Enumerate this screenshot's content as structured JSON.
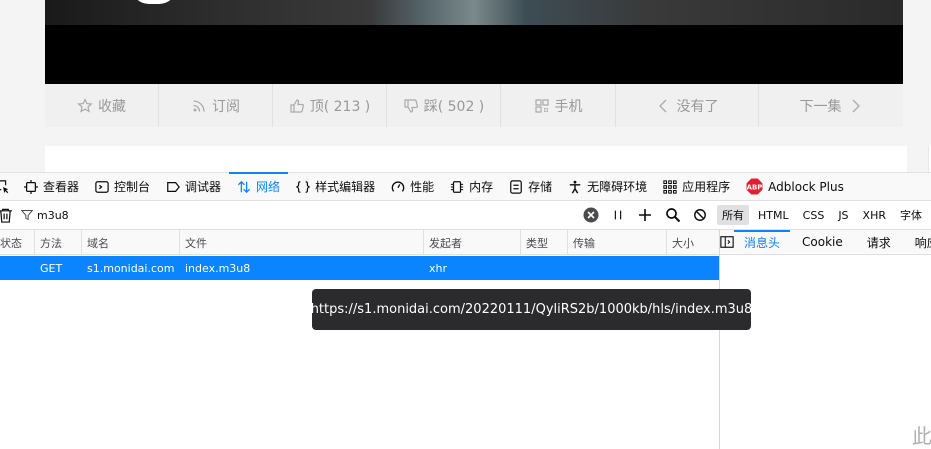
{
  "page": {
    "actions": [
      {
        "label": "收藏",
        "icon": "star-icon"
      },
      {
        "label": "订阅",
        "icon": "rss-icon"
      },
      {
        "label": "顶( 213 )",
        "icon": "thumbs-up-icon"
      },
      {
        "label": "踩( 502 )",
        "icon": "thumbs-down-icon"
      },
      {
        "label": "手机",
        "icon": "qr-code-icon"
      },
      {
        "label": "没有了",
        "icon": "chevron-left-icon"
      },
      {
        "label": "下一集",
        "icon": "chevron-right-icon"
      }
    ],
    "corner_text": "此"
  },
  "devtools": {
    "tabs": [
      {
        "label": "查看器",
        "icon": "inspector-icon"
      },
      {
        "label": "控制台",
        "icon": "console-icon"
      },
      {
        "label": "调试器",
        "icon": "debugger-icon"
      },
      {
        "label": "网络",
        "icon": "network-icon",
        "active": true
      },
      {
        "label": "样式编辑器",
        "icon": "braces-icon"
      },
      {
        "label": "性能",
        "icon": "gauge-icon"
      },
      {
        "label": "内存",
        "icon": "memory-chip-icon"
      },
      {
        "label": "存储",
        "icon": "storage-icon"
      },
      {
        "label": "无障碍环境",
        "icon": "accessibility-icon"
      },
      {
        "label": "应用程序",
        "icon": "grid-icon"
      },
      {
        "label": "Adblock Plus",
        "icon": "abp-icon"
      }
    ],
    "filter": {
      "value": "m3u8",
      "types": [
        "所有",
        "HTML",
        "CSS",
        "JS",
        "XHR",
        "字体"
      ],
      "active_type": "所有"
    },
    "columns": [
      "状态",
      "方法",
      "域名",
      "文件",
      "发起者",
      "类型",
      "传输",
      "大小"
    ],
    "rows": [
      {
        "status": "",
        "method": "GET",
        "domain": "s1.monidai.com",
        "file": "index.m3u8",
        "initiator": "xhr",
        "type": "",
        "transfer": "",
        "size": ""
      }
    ],
    "side_tabs": [
      "消息头",
      "Cookie",
      "请求",
      "响应"
    ],
    "tooltip": "https://s1.monidai.com/20220111/QyliRS2b/1000kb/hls/index.m3u8"
  },
  "colors": {
    "accent": "#0a84ff",
    "selected_row": "#0a84ff",
    "tooltip_bg": "#2b2b2e",
    "abp_red": "#e0202f"
  }
}
